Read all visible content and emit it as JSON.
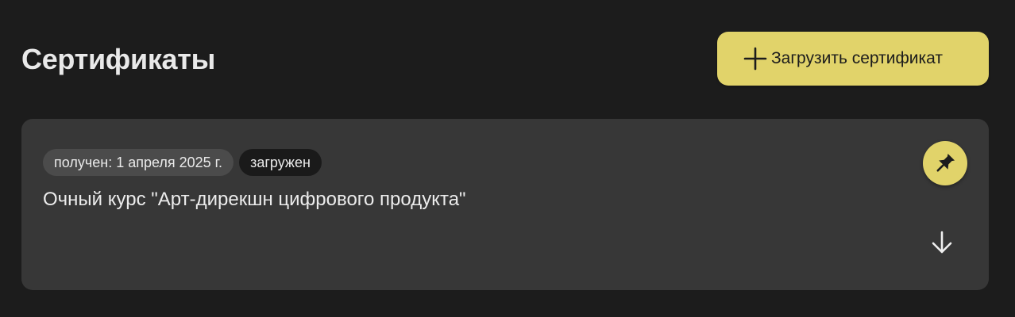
{
  "header": {
    "title": "Сертификаты",
    "upload_button_label": "Загрузить сертификат",
    "upload_icon": "plus-icon"
  },
  "certificate": {
    "received_tag": "получен: 1 апреля 2025 г.",
    "status_tag": "загружен",
    "title": "Очный курс \"Арт-дирекшн цифрового продукта\"",
    "pin_icon": "pin-icon",
    "download_icon": "arrow-down-icon"
  },
  "colors": {
    "background": "#1c1c1c",
    "card": "#373737",
    "accent": "#e1d36a",
    "text": "#ececec"
  }
}
